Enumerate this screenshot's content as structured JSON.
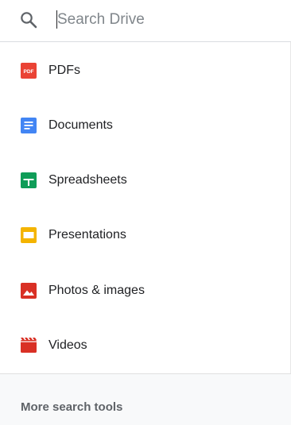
{
  "search": {
    "placeholder": "Search Drive",
    "value": ""
  },
  "file_types": [
    {
      "label": "PDFs",
      "icon": "pdf-icon",
      "color": "#ea4335"
    },
    {
      "label": "Documents",
      "icon": "document-icon",
      "color": "#4285f4"
    },
    {
      "label": "Spreadsheets",
      "icon": "spreadsheet-icon",
      "color": "#0f9d58"
    },
    {
      "label": "Presentations",
      "icon": "presentation-icon",
      "color": "#f4b400"
    },
    {
      "label": "Photos & images",
      "icon": "image-icon",
      "color": "#d93025"
    },
    {
      "label": "Videos",
      "icon": "video-icon",
      "color": "#d93025"
    }
  ],
  "pdf_icon_text": "PDF",
  "footer": {
    "more_tools_label": "More search tools"
  }
}
